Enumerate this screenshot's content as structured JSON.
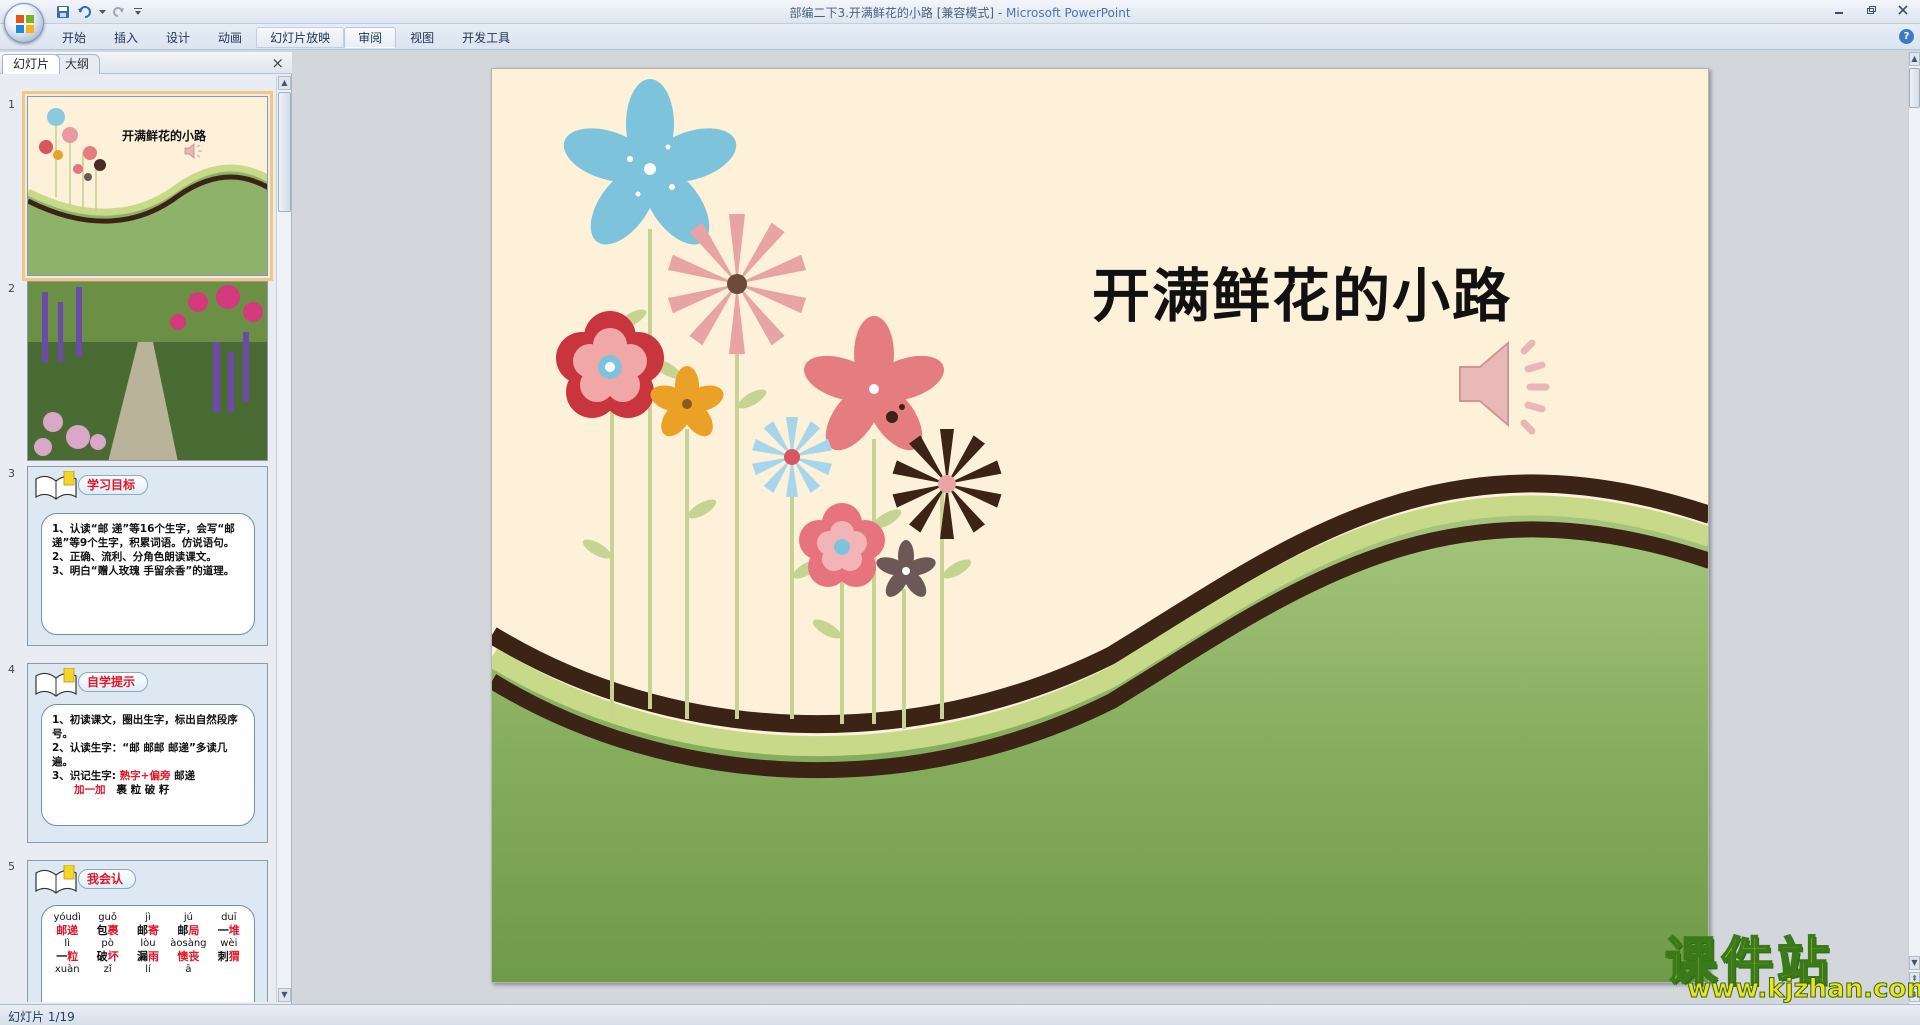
{
  "window": {
    "title": "部编二下3.开满鲜花的小路 [兼容模式]",
    "separator": " - ",
    "app": "Microsoft PowerPoint"
  },
  "ribbon": {
    "tabs": [
      "开始",
      "插入",
      "设计",
      "动画",
      "幻灯片放映",
      "审阅",
      "视图",
      "开发工具"
    ],
    "active_tab": "幻灯片放映",
    "help": "?"
  },
  "panel": {
    "tab_slides": "幻灯片",
    "tab_outline": "大纲",
    "close": "×"
  },
  "thumbnails": [
    {
      "num": "1",
      "title": "开满鲜花的小路"
    },
    {
      "num": "2"
    },
    {
      "num": "3",
      "badge": "学习目标",
      "lines": [
        "1、认读“邮 递”等16个生字，会写“邮 递”等9个生字，积累词语。仿说语句。",
        "2、正确、流利、分角色朗读课文。",
        "3、明白“赠人玫瑰 手留余香”的道理。"
      ]
    },
    {
      "num": "4",
      "badge": "自学提示",
      "lines": [
        "1、初读课文，圈出生字，标出自然段序号。",
        "2、认读生字：“邮 邮邮 邮递”多读几遍。"
      ],
      "line3_prefix": "3、识记生字:",
      "line3_red": "熟字+偏旁",
      "line3_word": "邮递",
      "line4_red": "加一加",
      "line4_rest": "裹 粒 破 籽"
    },
    {
      "num": "5",
      "badge": "我会认",
      "pinyin_row1": [
        "yóudì",
        "guǒ",
        "jì",
        "jú",
        "duī"
      ],
      "words_row1": [
        [
          "邮递",
          ""
        ],
        [
          "包",
          "裹"
        ],
        [
          "邮",
          "寄"
        ],
        [
          "邮",
          "局"
        ],
        [
          "一",
          "堆"
        ]
      ],
      "pinyin_row2": [
        "lì",
        "pò",
        "lòu",
        "àosàng",
        "wèi"
      ],
      "words_row2": [
        [
          "一",
          "粒"
        ],
        [
          "破",
          "坏"
        ],
        [
          "漏",
          "雨"
        ],
        [
          "懊丧",
          ""
        ],
        [
          "刺",
          "猬"
        ]
      ],
      "pinyin_row3": [
        "xuàn",
        "zǐ",
        "lí",
        "ā",
        ""
      ]
    }
  ],
  "slide": {
    "title": "开满鲜花的小路"
  },
  "status": {
    "text": "幻灯片 1/19"
  },
  "watermark": {
    "main": "课件站",
    "url": "www.kjzhan.com"
  },
  "colors": {
    "slide_bg": "#fdf1da",
    "hill_dark": "#3b2316",
    "hill_light": "#c9d98a",
    "grass": "#8fb26a",
    "accent_red": "#e3172a"
  }
}
